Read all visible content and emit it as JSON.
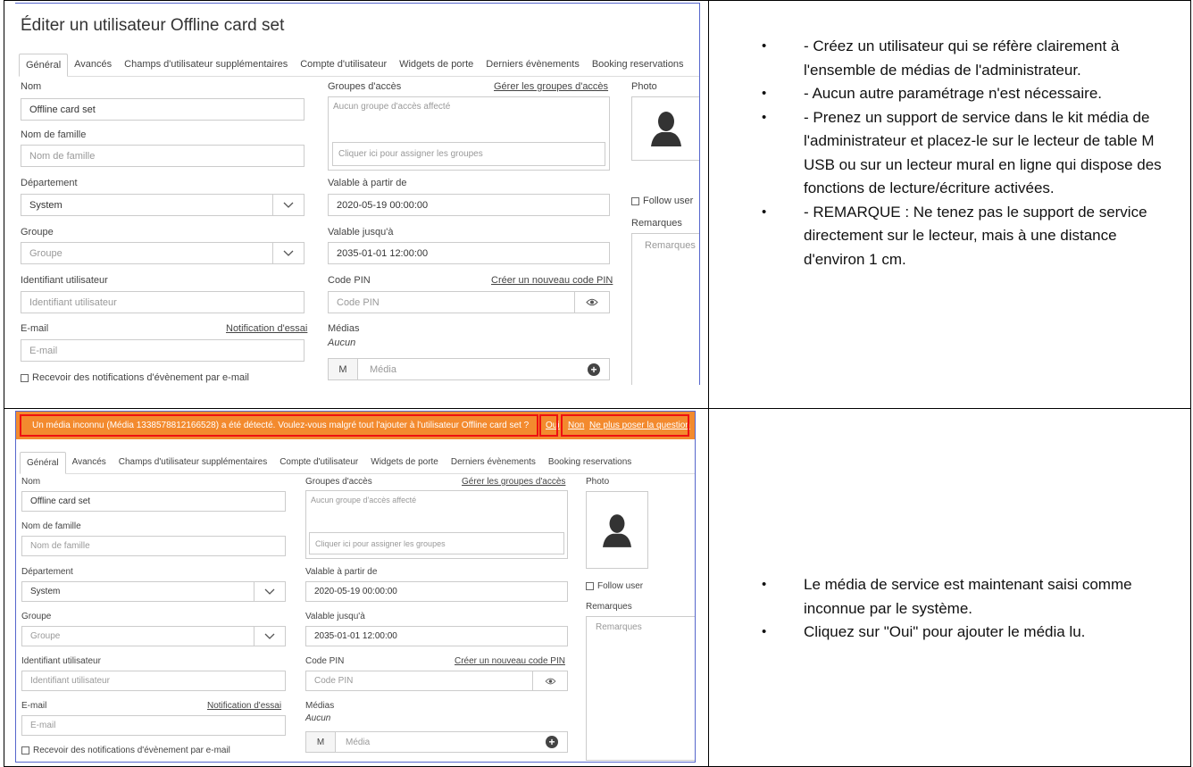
{
  "dialog_title": "Éditer un utilisateur Offline card set",
  "tabs": [
    "Général",
    "Avancés",
    "Champs d'utilisateur supplémentaires",
    "Compte d'utilisateur",
    "Widgets de porte",
    "Derniers évènements",
    "Booking reservations"
  ],
  "form": {
    "nom_label": "Nom",
    "nom_value": "Offline card set",
    "famille_label": "Nom de famille",
    "famille_placeholder": "Nom de famille",
    "dept_label": "Département",
    "dept_value": "System",
    "groupe_label": "Groupe",
    "groupe_placeholder": "Groupe",
    "ident_label": "Identifiant utilisateur",
    "ident_placeholder": "Identifiant utilisateur",
    "email_label": "E-mail",
    "notif_link": "Notification d'essai",
    "email_placeholder": "E-mail",
    "recv_label": "Recevoir des notifications d'évènement par e-mail",
    "groups_label": "Groupes d'accès",
    "groups_link": "Gérer les groupes d'accès",
    "groups_empty": "Aucun groupe d'accès affecté",
    "assign_placeholder": "Cliquer ici pour assigner les groupes",
    "valid_from_label": "Valable à partir de",
    "valid_from_value": "2020-05-19 00:00:00",
    "valid_to_label": "Valable jusqu'à",
    "valid_to_value": "2035-01-01 12:00:00",
    "pin_label": "Code PIN",
    "pin_link": "Créer un nouveau code PIN",
    "pin_placeholder": "Code PIN",
    "media_label": "Médias",
    "media_none": "Aucun",
    "media_btn": "M",
    "media_placeholder": "Média",
    "photo_label": "Photo",
    "follow_label": "Follow user",
    "remarks_label": "Remarques",
    "remarks_placeholder": "Remarques"
  },
  "notice": {
    "message": "Un média inconnu (Média 1338578812166528) a été détecté. Voulez-vous malgré tout l'ajouter à l'utilisateur Offline card set ?",
    "yes": "Oui",
    "no": "Non",
    "never": "Ne plus poser la question"
  },
  "instructions_top": [
    "- Créez un utilisateur qui se réfère clairement à l'ensemble de médias de l'administrateur.",
    "- Aucun autre paramétrage n'est nécessaire.",
    "- Prenez un support de service dans le kit média de l'administrateur et placez-le sur le lecteur de table M USB ou sur un lecteur mural en ligne qui dispose des fonctions de lecture/écriture activées.",
    "- REMARQUE : Ne tenez pas le support de service directement sur le lecteur, mais à une distance d'environ 1 cm."
  ],
  "instructions_bottom": [
    "Le média de service est maintenant saisi comme inconnue par le système.",
    "Cliquez sur \"Oui\" pour ajouter le média lu."
  ],
  "colors": {
    "notice_bg": "#f38a2e",
    "highlight": "#e11111"
  }
}
